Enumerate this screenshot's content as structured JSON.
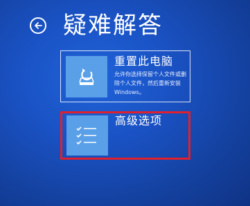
{
  "header": {
    "title": "疑难解答"
  },
  "options": [
    {
      "title": "重置此电脑",
      "description": "允许你选择保留个人文件或删除个人文件，然后重新安装 Windows。",
      "icon": "reset-pc-icon"
    },
    {
      "title": "高级选项",
      "description": "",
      "icon": "checklist-icon"
    }
  ],
  "colors": {
    "background": "#1a52c4",
    "icon_tile": "#5aa0e8",
    "highlight": "#e0202c"
  }
}
